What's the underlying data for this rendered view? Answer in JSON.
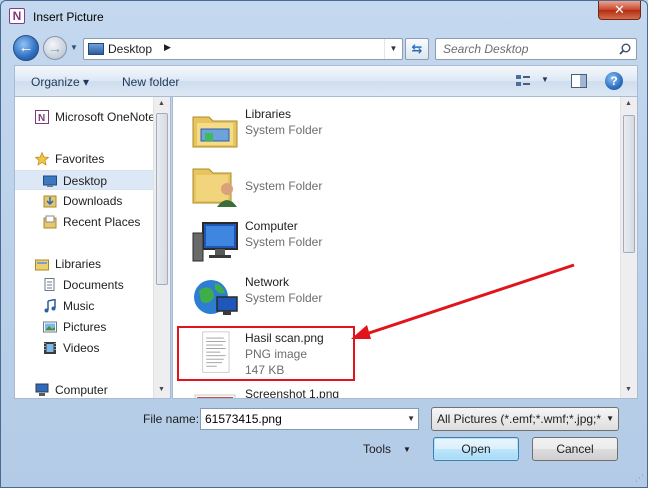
{
  "window": {
    "title": "Insert Picture",
    "close_glyph": "✕",
    "app_icon_letter": "N"
  },
  "nav": {
    "back_glyph": "←",
    "forward_glyph": "→",
    "address": "Desktop",
    "search_placeholder": "Search Desktop"
  },
  "toolbar": {
    "organize_label": "Organize ▾",
    "new_folder_label": "New folder"
  },
  "sidebar": {
    "items": [
      {
        "label": "Microsoft OneNote",
        "icon": "onenote-icon"
      },
      {
        "label": "Favorites",
        "icon": "star-icon"
      },
      {
        "label": "Desktop",
        "icon": "desktop-icon",
        "selected": true
      },
      {
        "label": "Downloads",
        "icon": "downloads-icon"
      },
      {
        "label": "Recent Places",
        "icon": "recent-places-icon"
      },
      {
        "label": "Libraries",
        "icon": "libraries-icon"
      },
      {
        "label": "Documents",
        "icon": "documents-icon"
      },
      {
        "label": "Music",
        "icon": "music-icon"
      },
      {
        "label": "Pictures",
        "icon": "pictures-icon"
      },
      {
        "label": "Videos",
        "icon": "videos-icon"
      },
      {
        "label": "Computer",
        "icon": "computer-icon"
      }
    ]
  },
  "files": [
    {
      "name": "Libraries",
      "type": "System Folder",
      "size": "",
      "icon": "libraries-folder-icon"
    },
    {
      "name": "",
      "type": "System Folder",
      "size": "",
      "icon": "user-folder-icon"
    },
    {
      "name": "Computer",
      "type": "System Folder",
      "size": "",
      "icon": "computer-icon"
    },
    {
      "name": "Network",
      "type": "System Folder",
      "size": "",
      "icon": "network-icon"
    },
    {
      "name": "Hasil scan.png",
      "type": "PNG image",
      "size": "147 KB",
      "icon": "image-thumbnail-icon",
      "highlighted": true
    },
    {
      "name": "Screenshot 1.png",
      "type": "",
      "size": "",
      "icon": "image-thumbnail-icon"
    }
  ],
  "footer": {
    "file_name_label": "File name:",
    "file_name_value": "61573415.png",
    "file_type": "All Pictures (*.emf;*.wmf;*.jpg;*",
    "tools_label": "Tools",
    "open_label": "Open",
    "cancel_label": "Cancel"
  },
  "colors": {
    "highlight": "#e0141a",
    "selection": "#dce8f6",
    "chrome": "#b9d1ea"
  }
}
